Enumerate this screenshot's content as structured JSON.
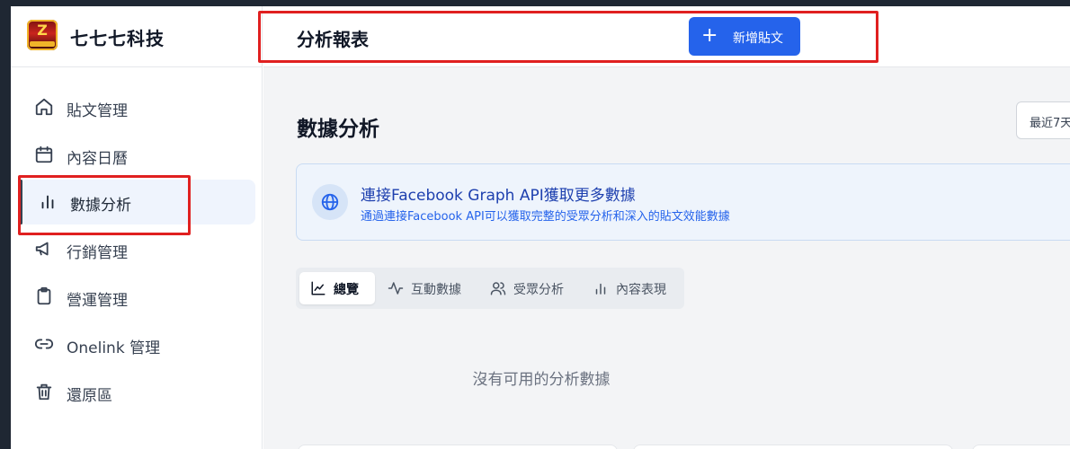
{
  "brand": {
    "name": "七七七科技",
    "logo_text": "Z"
  },
  "header": {
    "title": "分析報表",
    "new_post_label": "新增貼文"
  },
  "sidebar": {
    "items": [
      {
        "label": "貼文管理",
        "icon": "home-icon"
      },
      {
        "label": "內容日曆",
        "icon": "calendar-icon"
      },
      {
        "label": "數據分析",
        "icon": "bar-chart-icon",
        "active": true
      },
      {
        "label": "行銷管理",
        "icon": "megaphone-icon"
      },
      {
        "label": "營運管理",
        "icon": "clipboard-icon"
      },
      {
        "label": "Onelink 管理",
        "icon": "link-icon"
      },
      {
        "label": "還原區",
        "icon": "trash-icon"
      }
    ]
  },
  "main": {
    "section_title": "數據分析",
    "range_select": {
      "value": "最近7天"
    },
    "banner": {
      "icon": "globe-icon",
      "title": "連接Facebook Graph API獲取更多數據",
      "description": "通過連接Facebook API可以獲取完整的受眾分析和深入的貼文效能數據"
    },
    "tabs": [
      {
        "label": "總覽",
        "icon": "area-chart-icon",
        "active": true
      },
      {
        "label": "互動數據",
        "icon": "activity-icon"
      },
      {
        "label": "受眾分析",
        "icon": "users-icon"
      },
      {
        "label": "內容表現",
        "icon": "bar-chart-icon"
      }
    ],
    "empty_message": "沒有可用的分析數據"
  },
  "colors": {
    "primary": "#2563eb",
    "active_nav_bg": "#eff4fd",
    "banner_bg": "#eef4fc",
    "annotation": "#e02020"
  }
}
